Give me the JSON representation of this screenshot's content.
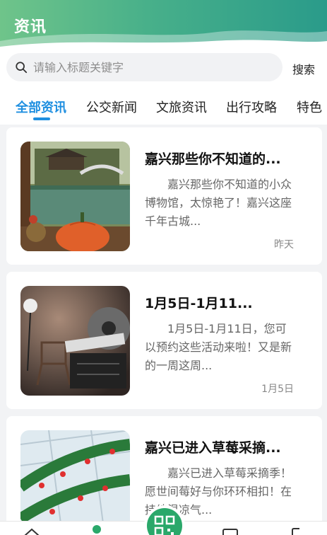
{
  "header": {
    "title": "资讯"
  },
  "search": {
    "placeholder": "请输入标题关键字",
    "value": "",
    "button_label": "搜索"
  },
  "tabs": [
    {
      "label": "全部资讯",
      "active": true
    },
    {
      "label": "公交新闻",
      "active": false
    },
    {
      "label": "文旅资讯",
      "active": false
    },
    {
      "label": "出行攻略",
      "active": false
    },
    {
      "label": "特色",
      "active": false
    }
  ],
  "articles": [
    {
      "title": "嘉兴那些你不知道的...",
      "summary": "嘉兴那些你不知道的小众博物馆，太惊艳了！嘉兴这座千年古城...",
      "date": "昨天",
      "thumbnail": "garden-pumpkin-image"
    },
    {
      "title": "1月5日-1月11...",
      "summary": "1月5日-1月11日，您可以预约这些活动来啦！又是新的一周这周...",
      "date": "1月5日",
      "thumbnail": "film-clapperboard-image"
    },
    {
      "title": "嘉兴已进入草莓采摘...",
      "summary": "嘉兴已进入草莓采摘季！愿世间莓好与你环环相扣！在持续温凉气...",
      "date": "",
      "thumbnail": "strawberry-greenhouse-image"
    }
  ],
  "colors": {
    "accent": "#1f8fe0",
    "header_start": "#6fc48a",
    "header_end": "#2a9b8a",
    "scan_button": "#2aa86a"
  },
  "bottom_nav": {
    "center_icon": "qr-scan-icon"
  }
}
